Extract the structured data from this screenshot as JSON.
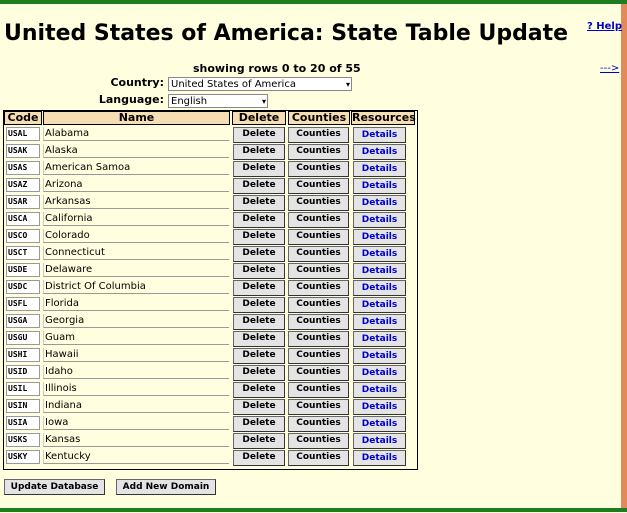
{
  "page": {
    "title": "United States of America: State Table Update",
    "help_link": "? Help",
    "next_link": "--->",
    "rows_info": "showing rows 0 to 20 of 55"
  },
  "filters": {
    "country_label": "Country:",
    "country_value": "United States of America",
    "language_label": "Language:",
    "language_value": "English"
  },
  "table": {
    "headers": [
      "Code",
      "Name",
      "Delete",
      "Counties",
      "Resources"
    ],
    "delete_label": "Delete",
    "counties_label": "Counties",
    "details_label": "Details",
    "rows": [
      {
        "code": "USAL",
        "name": "Alabama"
      },
      {
        "code": "USAK",
        "name": "Alaska"
      },
      {
        "code": "USAS",
        "name": "American Samoa"
      },
      {
        "code": "USAZ",
        "name": "Arizona"
      },
      {
        "code": "USAR",
        "name": "Arkansas"
      },
      {
        "code": "USCA",
        "name": "California"
      },
      {
        "code": "USCO",
        "name": "Colorado"
      },
      {
        "code": "USCT",
        "name": "Connecticut"
      },
      {
        "code": "USDE",
        "name": "Delaware"
      },
      {
        "code": "USDC",
        "name": "District Of Columbia"
      },
      {
        "code": "USFL",
        "name": "Florida"
      },
      {
        "code": "USGA",
        "name": "Georgia"
      },
      {
        "code": "USGU",
        "name": "Guam"
      },
      {
        "code": "USHI",
        "name": "Hawaii"
      },
      {
        "code": "USID",
        "name": "Idaho"
      },
      {
        "code": "USIL",
        "name": "Illinois"
      },
      {
        "code": "USIN",
        "name": "Indiana"
      },
      {
        "code": "USIA",
        "name": "Iowa"
      },
      {
        "code": "USKS",
        "name": "Kansas"
      },
      {
        "code": "USKY",
        "name": "Kentucky"
      }
    ]
  },
  "actions": {
    "update_label": "Update Database",
    "add_label": "Add New Domain"
  },
  "colors": {
    "background": "#ffffe0",
    "header_bg": "#f5deb3",
    "rule": "#1e7d1e",
    "link": "#0000cc"
  }
}
